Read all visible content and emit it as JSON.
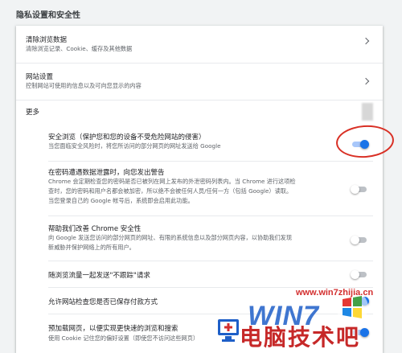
{
  "section_title": "隐私设置和安全性",
  "rows": {
    "clear_data": {
      "title": "清除浏览数据",
      "subtitle": "清除浏览记录、Cookie、缓存及其他数据"
    },
    "site_settings": {
      "title": "网站设置",
      "subtitle": "控制网站可使用的信息以及可向您显示的内容"
    },
    "more": {
      "title": "更多"
    },
    "safe_browsing": {
      "title": "安全浏览（保护您和您的设备不受危险网站的侵害）",
      "subtitle": "当您面临安全风险时，将您所访问的部分网页的网址发送给 Google",
      "enabled": true
    },
    "password_leak": {
      "title": "在密码遭遇数据泄露时，向您发出警告",
      "line1": "Chrome 会定期检查您的密码是否已被列在网上发布的外泄密码列表内。当 Chrome 进行这项检",
      "line2": "查时，您的密码和用户名都会被加密，所以绝不会被任何人员/任何一方（包括 Google）读取。",
      "line3": "当您登录自己的 Google 帐号后，系统即会启用此功能。",
      "enabled": false
    },
    "improve_security": {
      "title": "帮助我们改善 Chrome 安全性",
      "line1": "向 Google 发送您访问的部分网页的网址、有限的系统信息以及部分网页内容，以协助我们发现",
      "line2": "新威胁并保护网络上的所有用户。",
      "enabled": false
    },
    "do_not_track": {
      "title": "随浏览流量一起发送\"不跟踪\"请求",
      "enabled": false
    },
    "payment_methods": {
      "title": "允许网站检查您是否已保存付款方式",
      "enabled": true
    },
    "preload": {
      "title": "预加载网页，以便实现更快速的浏览和搜索",
      "subtitle": "使用 Cookie 记住您的偏好设置（即使您不访问这些网页）",
      "enabled": true
    }
  },
  "watermark": {
    "url": "www.win7zhijia.cn",
    "logo": "WIN7",
    "cn": "电脑技术吧"
  },
  "colors": {
    "accent": "#1a73e8",
    "annotation": "#d93025"
  }
}
